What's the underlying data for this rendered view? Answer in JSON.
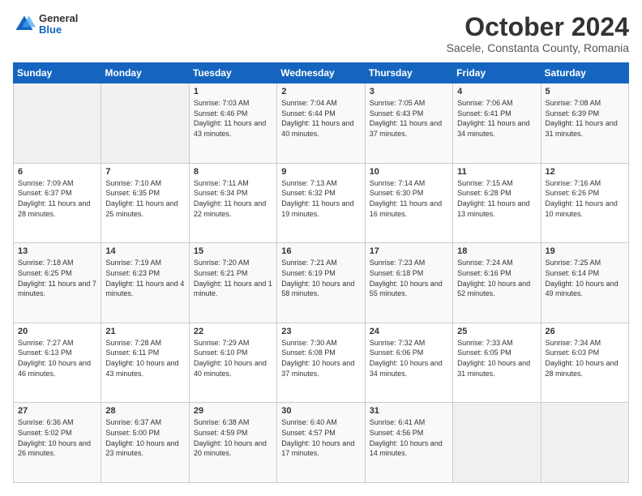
{
  "logo": {
    "general": "General",
    "blue": "Blue"
  },
  "header": {
    "month": "October 2024",
    "location": "Sacele, Constanta County, Romania"
  },
  "days_of_week": [
    "Sunday",
    "Monday",
    "Tuesday",
    "Wednesday",
    "Thursday",
    "Friday",
    "Saturday"
  ],
  "weeks": [
    [
      {
        "day": "",
        "content": ""
      },
      {
        "day": "",
        "content": ""
      },
      {
        "day": "1",
        "content": "Sunrise: 7:03 AM\nSunset: 6:46 PM\nDaylight: 11 hours and 43 minutes."
      },
      {
        "day": "2",
        "content": "Sunrise: 7:04 AM\nSunset: 6:44 PM\nDaylight: 11 hours and 40 minutes."
      },
      {
        "day": "3",
        "content": "Sunrise: 7:05 AM\nSunset: 6:43 PM\nDaylight: 11 hours and 37 minutes."
      },
      {
        "day": "4",
        "content": "Sunrise: 7:06 AM\nSunset: 6:41 PM\nDaylight: 11 hours and 34 minutes."
      },
      {
        "day": "5",
        "content": "Sunrise: 7:08 AM\nSunset: 6:39 PM\nDaylight: 11 hours and 31 minutes."
      }
    ],
    [
      {
        "day": "6",
        "content": "Sunrise: 7:09 AM\nSunset: 6:37 PM\nDaylight: 11 hours and 28 minutes."
      },
      {
        "day": "7",
        "content": "Sunrise: 7:10 AM\nSunset: 6:35 PM\nDaylight: 11 hours and 25 minutes."
      },
      {
        "day": "8",
        "content": "Sunrise: 7:11 AM\nSunset: 6:34 PM\nDaylight: 11 hours and 22 minutes."
      },
      {
        "day": "9",
        "content": "Sunrise: 7:13 AM\nSunset: 6:32 PM\nDaylight: 11 hours and 19 minutes."
      },
      {
        "day": "10",
        "content": "Sunrise: 7:14 AM\nSunset: 6:30 PM\nDaylight: 11 hours and 16 minutes."
      },
      {
        "day": "11",
        "content": "Sunrise: 7:15 AM\nSunset: 6:28 PM\nDaylight: 11 hours and 13 minutes."
      },
      {
        "day": "12",
        "content": "Sunrise: 7:16 AM\nSunset: 6:26 PM\nDaylight: 11 hours and 10 minutes."
      }
    ],
    [
      {
        "day": "13",
        "content": "Sunrise: 7:18 AM\nSunset: 6:25 PM\nDaylight: 11 hours and 7 minutes."
      },
      {
        "day": "14",
        "content": "Sunrise: 7:19 AM\nSunset: 6:23 PM\nDaylight: 11 hours and 4 minutes."
      },
      {
        "day": "15",
        "content": "Sunrise: 7:20 AM\nSunset: 6:21 PM\nDaylight: 11 hours and 1 minute."
      },
      {
        "day": "16",
        "content": "Sunrise: 7:21 AM\nSunset: 6:19 PM\nDaylight: 10 hours and 58 minutes."
      },
      {
        "day": "17",
        "content": "Sunrise: 7:23 AM\nSunset: 6:18 PM\nDaylight: 10 hours and 55 minutes."
      },
      {
        "day": "18",
        "content": "Sunrise: 7:24 AM\nSunset: 6:16 PM\nDaylight: 10 hours and 52 minutes."
      },
      {
        "day": "19",
        "content": "Sunrise: 7:25 AM\nSunset: 6:14 PM\nDaylight: 10 hours and 49 minutes."
      }
    ],
    [
      {
        "day": "20",
        "content": "Sunrise: 7:27 AM\nSunset: 6:13 PM\nDaylight: 10 hours and 46 minutes."
      },
      {
        "day": "21",
        "content": "Sunrise: 7:28 AM\nSunset: 6:11 PM\nDaylight: 10 hours and 43 minutes."
      },
      {
        "day": "22",
        "content": "Sunrise: 7:29 AM\nSunset: 6:10 PM\nDaylight: 10 hours and 40 minutes."
      },
      {
        "day": "23",
        "content": "Sunrise: 7:30 AM\nSunset: 6:08 PM\nDaylight: 10 hours and 37 minutes."
      },
      {
        "day": "24",
        "content": "Sunrise: 7:32 AM\nSunset: 6:06 PM\nDaylight: 10 hours and 34 minutes."
      },
      {
        "day": "25",
        "content": "Sunrise: 7:33 AM\nSunset: 6:05 PM\nDaylight: 10 hours and 31 minutes."
      },
      {
        "day": "26",
        "content": "Sunrise: 7:34 AM\nSunset: 6:03 PM\nDaylight: 10 hours and 28 minutes."
      }
    ],
    [
      {
        "day": "27",
        "content": "Sunrise: 6:36 AM\nSunset: 5:02 PM\nDaylight: 10 hours and 26 minutes."
      },
      {
        "day": "28",
        "content": "Sunrise: 6:37 AM\nSunset: 5:00 PM\nDaylight: 10 hours and 23 minutes."
      },
      {
        "day": "29",
        "content": "Sunrise: 6:38 AM\nSunset: 4:59 PM\nDaylight: 10 hours and 20 minutes."
      },
      {
        "day": "30",
        "content": "Sunrise: 6:40 AM\nSunset: 4:57 PM\nDaylight: 10 hours and 17 minutes."
      },
      {
        "day": "31",
        "content": "Sunrise: 6:41 AM\nSunset: 4:56 PM\nDaylight: 10 hours and 14 minutes."
      },
      {
        "day": "",
        "content": ""
      },
      {
        "day": "",
        "content": ""
      }
    ]
  ]
}
